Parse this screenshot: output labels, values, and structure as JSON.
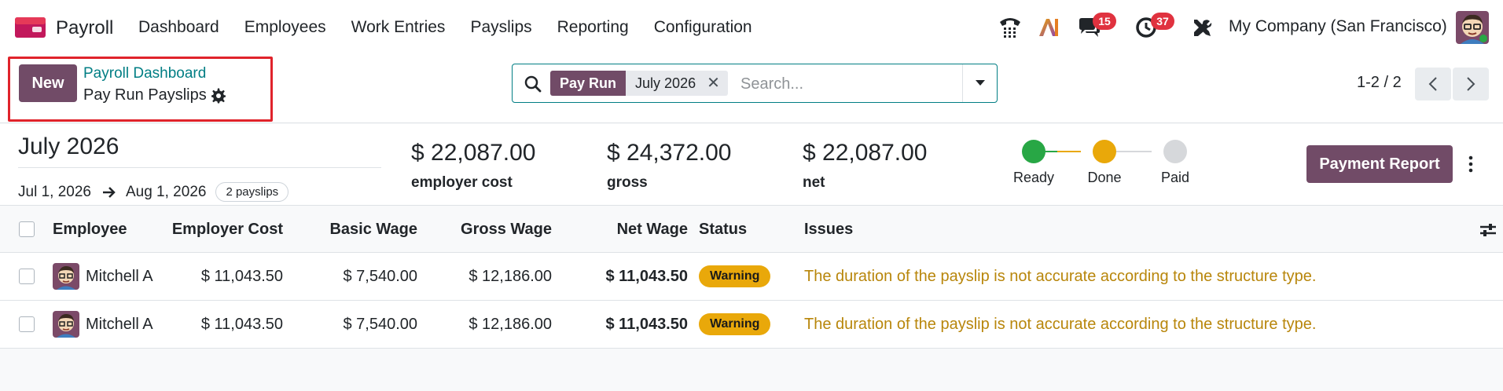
{
  "app": {
    "name": "Payroll",
    "menu": [
      "Dashboard",
      "Employees",
      "Work Entries",
      "Payslips",
      "Reporting",
      "Configuration"
    ],
    "messages_badge": "15",
    "activities_badge": "37",
    "company": "My Company (San Francisco)",
    "ai_label": "AI"
  },
  "control_panel": {
    "new_label": "New",
    "breadcrumb_parent": "Payroll Dashboard",
    "breadcrumb_current": "Pay Run Payslips",
    "search": {
      "facet_label": "Pay Run",
      "facet_value": "July 2026",
      "placeholder": "Search..."
    },
    "pager": "1-2 / 2"
  },
  "payrun": {
    "title": "July 2026",
    "date_from": "Jul 1, 2026",
    "date_to": "Aug 1, 2026",
    "payslip_count": "2 payslips",
    "stats": [
      {
        "amount": "$ 22,087.00",
        "label": "employer cost"
      },
      {
        "amount": "$ 24,372.00",
        "label": "gross"
      },
      {
        "amount": "$ 22,087.00",
        "label": "net"
      }
    ],
    "steps": [
      {
        "label": "Ready",
        "color": "#28a745"
      },
      {
        "label": "Done",
        "color": "#e9a80a"
      },
      {
        "label": "Paid",
        "color": "#d6d8db"
      }
    ],
    "payment_report_label": "Payment Report"
  },
  "table": {
    "columns": [
      "Employee",
      "Employer Cost",
      "Basic Wage",
      "Gross Wage",
      "Net Wage",
      "Status",
      "Issues"
    ],
    "rows": [
      {
        "employee": "Mitchell Admin",
        "employer_cost": "$ 11,043.50",
        "basic_wage": "$ 7,540.00",
        "gross_wage": "$ 12,186.00",
        "net_wage": "$ 11,043.50",
        "status": "Warning",
        "issue": "The duration of the payslip is not accurate according to the structure type."
      },
      {
        "employee": "Mitchell Admin",
        "employer_cost": "$ 11,043.50",
        "basic_wage": "$ 7,540.00",
        "gross_wage": "$ 12,186.00",
        "net_wage": "$ 11,043.50",
        "status": "Warning",
        "issue": "The duration of the payslip is not accurate according to the structure type."
      }
    ]
  },
  "colors": {
    "brand": "#714b67",
    "link": "#017e84",
    "warning": "#e9a80a",
    "highlight": "#e0232b"
  }
}
